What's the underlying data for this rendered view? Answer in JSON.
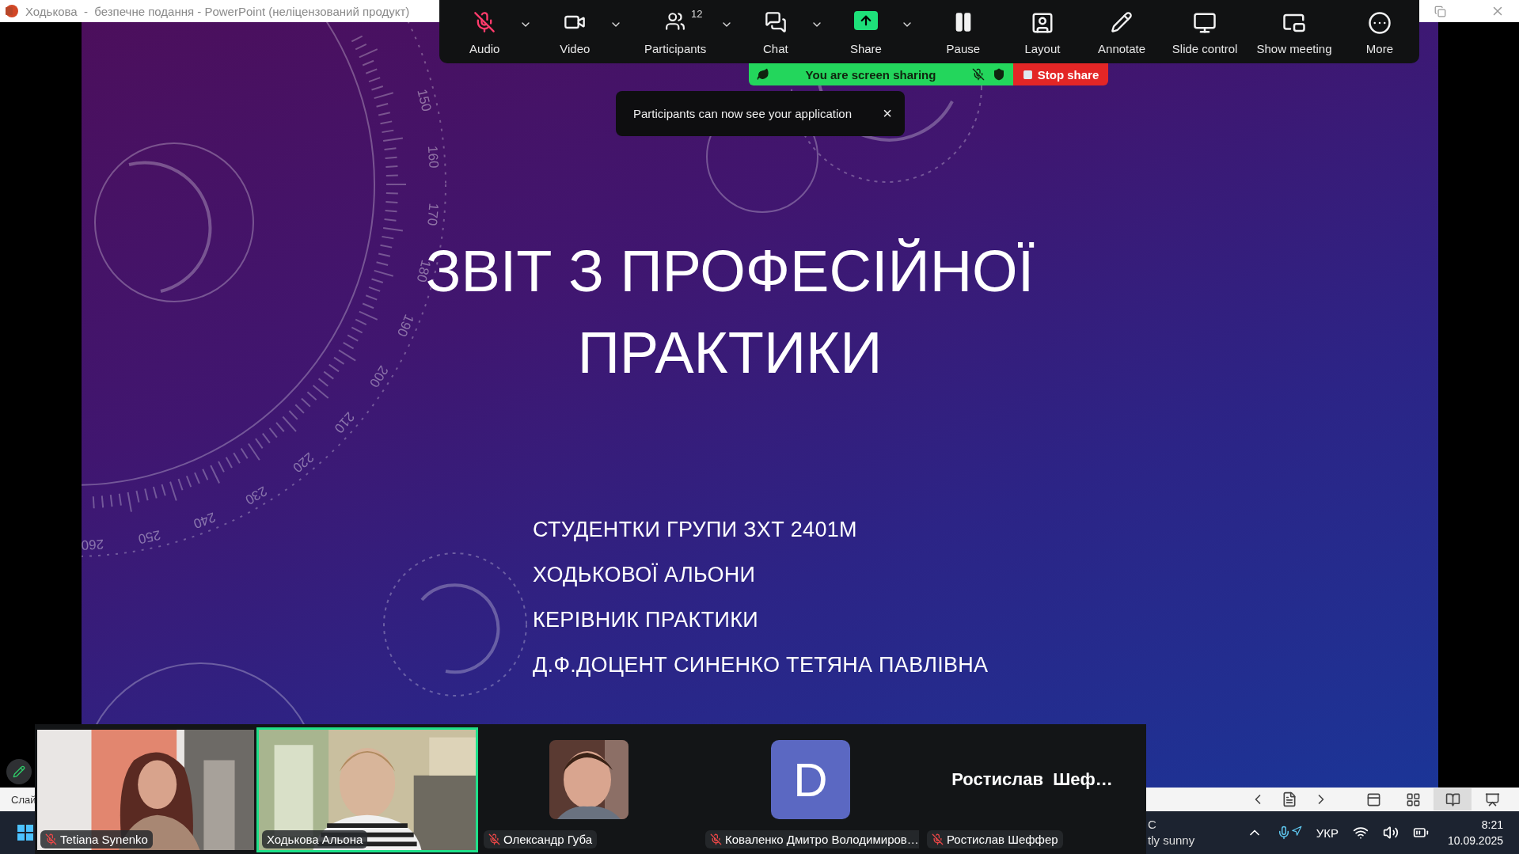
{
  "window": {
    "title": "Ходькова  -  безпечне подання - PowerPoint (неліцензований продукт)"
  },
  "meeting_toolbar": {
    "buttons": [
      {
        "label": "Audio",
        "kind": "audio",
        "muted": true,
        "menu": true
      },
      {
        "label": "Video",
        "kind": "video",
        "menu": true
      },
      {
        "label": "Participants",
        "kind": "participants",
        "count": "12",
        "menu": true
      },
      {
        "label": "Chat",
        "kind": "chat",
        "menu": true
      },
      {
        "label": "Share",
        "kind": "share",
        "menu": true
      },
      {
        "label": "Pause",
        "kind": "pause",
        "menu": false
      },
      {
        "label": "Layout",
        "kind": "layout",
        "menu": false
      },
      {
        "label": "Annotate",
        "kind": "annotate",
        "menu": false
      },
      {
        "label": "Slide control",
        "kind": "slide_control",
        "menu": false
      },
      {
        "label": "Show meeting",
        "kind": "show_meeting",
        "menu": false
      },
      {
        "label": "More",
        "kind": "more",
        "menu": false
      }
    ]
  },
  "share_banner": {
    "status": "You are screen sharing",
    "stop_label": "Stop share"
  },
  "toast": {
    "message": "Participants can now see your application",
    "close": "×"
  },
  "slide": {
    "title_lines": [
      "ЗВІТ З ПРОФЕСІЙНОЇ",
      "ПРАКТИКИ"
    ],
    "subtitle_lines": [
      "СТУДЕНТКИ ГРУПИ ЗХТ 2401М",
      "ХОДЬКОВОЇ АЛЬОНИ",
      "КЕРІВНИК ПРАКТИКИ",
      "Д.Ф.ДОЦЕНТ СИНЕНКО ТЕТЯНА ПАВЛІВНА"
    ],
    "dial_labels": [
      "150",
      "160",
      "170",
      "180",
      "190",
      "200",
      "210",
      "220",
      "230",
      "240",
      "250",
      "260"
    ]
  },
  "video_strip": {
    "tiles": [
      {
        "name": "Tetiana Synenko",
        "kind": "video",
        "active": false,
        "muted": true
      },
      {
        "name": "Ходькова Альона",
        "kind": "video",
        "active": true,
        "muted": false
      },
      {
        "name": "Олександр Губа",
        "active": false,
        "muted": true
      },
      {
        "name": "Коваленко Дмитро Володимиров…",
        "kind": "avatar",
        "initial": "D",
        "color": "#5b68c2",
        "active": false,
        "muted": true
      },
      {
        "name": "Ростислав Шеффер",
        "kind": "name",
        "display": "Ростислав  Шеф…",
        "active": false,
        "muted": true
      }
    ]
  },
  "powerpoint_status": {
    "left_text": "Слай",
    "views": [
      {
        "kind": "normal",
        "selected": false
      },
      {
        "kind": "sorter",
        "selected": false
      },
      {
        "kind": "reading",
        "selected": true
      },
      {
        "kind": "slideshow",
        "selected": false
      }
    ]
  },
  "taskbar": {
    "weather_temp": "C",
    "weather_text": "tly sunny",
    "language": "УКР",
    "time": "8:21",
    "date": "10.09.2025"
  }
}
